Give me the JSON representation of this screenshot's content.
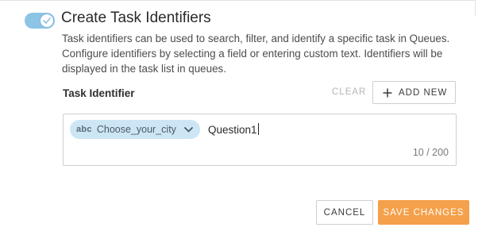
{
  "section": {
    "toggle_on": true,
    "title": "Create Task Identifiers",
    "description": "Task identifiers can be used to search, filter, and identify a specific task in Queues. Configure identifiers by selecting a field or entering custom text. Identifiers will be displayed in the task list in queues."
  },
  "identifier_field": {
    "label": "Task Identifier",
    "clear_label": "CLEAR",
    "add_new_label": "ADD NEW",
    "chip": {
      "type_icon_text": "abc",
      "field_name": "Choose_your_city"
    },
    "typed_text": "Question1",
    "char_count": "10 / 200"
  },
  "footer": {
    "cancel_label": "CANCEL",
    "save_label": "SAVE CHANGES"
  },
  "colors": {
    "toggle_on": "#8cc4e6",
    "chip_bg": "#cde6f6",
    "primary_button": "#f5a04a"
  }
}
